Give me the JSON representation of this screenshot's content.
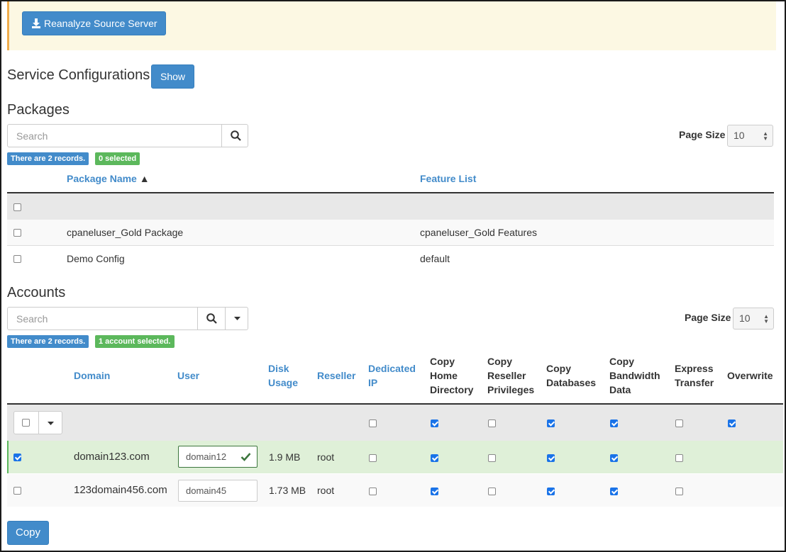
{
  "top": {
    "reanalyze_label": "Reanalyze Source Server"
  },
  "service_configurations": {
    "title": "Service Configurations",
    "show_label": "Show"
  },
  "packages": {
    "title": "Packages",
    "search_placeholder": "Search",
    "page_size_label": "Page Size",
    "page_size_value": "10",
    "records_badge": "There are 2 records.",
    "selected_badge": "0 selected",
    "columns": {
      "package_name": "Package Name",
      "sort_indicator": "▲",
      "feature_list": "Feature List"
    },
    "rows": [
      {
        "package_name": "cpaneluser_Gold Package",
        "feature_list": "cpaneluser_Gold Features",
        "checked": false
      },
      {
        "package_name": "Demo Config",
        "feature_list": "default",
        "checked": false
      }
    ]
  },
  "accounts": {
    "title": "Accounts",
    "search_placeholder": "Search",
    "page_size_label": "Page Size",
    "page_size_value": "10",
    "records_badge": "There are 2 records.",
    "selected_badge": "1 account selected.",
    "columns": {
      "domain": "Domain",
      "user": "User",
      "disk_usage_1": "Disk",
      "disk_usage_2": "Usage",
      "reseller": "Reseller",
      "dedicated_ip_1": "Dedicated",
      "dedicated_ip_2": "IP",
      "copy_home_1": "Copy",
      "copy_home_2": "Home",
      "copy_home_3": "Directory",
      "copy_reseller_1": "Copy",
      "copy_reseller_2": "Reseller",
      "copy_reseller_3": "Privileges",
      "copy_db_1": "Copy",
      "copy_db_2": "Databases",
      "copy_bw_1": "Copy",
      "copy_bw_2": "Bandwidth",
      "copy_bw_3": "Data",
      "express_1": "Express",
      "express_2": "Transfer",
      "overwrite": "Overwrite"
    },
    "bulk_row": {
      "dedicated_ip": false,
      "copy_home": true,
      "copy_reseller": false,
      "copy_db": true,
      "copy_bw": true,
      "express": false,
      "overwrite": true
    },
    "rows": [
      {
        "selected": true,
        "domain": "domain123.com",
        "user": "domain12",
        "disk_usage": "1.9 MB",
        "reseller": "root",
        "dedicated_ip": false,
        "copy_home": true,
        "copy_reseller": false,
        "copy_db": true,
        "copy_bw": true,
        "express": false
      },
      {
        "selected": false,
        "domain": "123domain456.com",
        "user": "domain45",
        "disk_usage": "1.73 MB",
        "reseller": "root",
        "dedicated_ip": false,
        "copy_home": true,
        "copy_reseller": false,
        "copy_db": true,
        "copy_bw": true,
        "express": false
      }
    ]
  },
  "footer": {
    "copy_label": "Copy"
  },
  "colors": {
    "primary": "#428bca",
    "success": "#5cb85c",
    "warning_bg": "#fcf8e3",
    "selected_row_bg": "#dff0d8"
  },
  "icons": [
    "download-icon",
    "search-icon",
    "caret-down-icon",
    "checkmark-icon"
  ]
}
